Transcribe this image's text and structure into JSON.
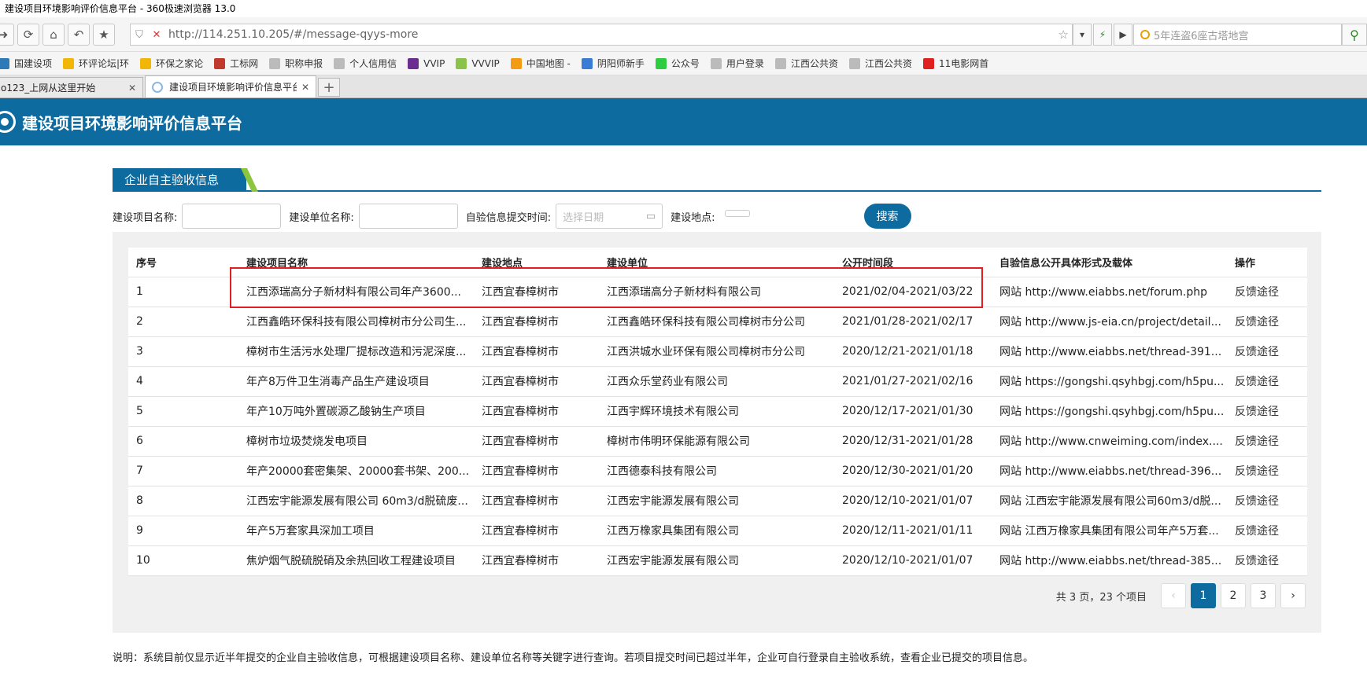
{
  "window": {
    "title": "建设项目环境影响评价信息平台 - 360极速浏览器 13.0"
  },
  "address_bar": {
    "url": "http://114.251.10.205/#/message-qyys-more"
  },
  "search_box": {
    "placeholder": "5年连盗6座古塔地宫"
  },
  "bookmarks": [
    {
      "label": "国建设项",
      "color": "#2e7ab8"
    },
    {
      "label": "环评论坛|环",
      "color": "#f2b705"
    },
    {
      "label": "环保之家论",
      "color": "#f2b705"
    },
    {
      "label": "工标网",
      "color": "#c0392b"
    },
    {
      "label": "职称申报",
      "color": "#bbbbbb"
    },
    {
      "label": "个人信用信",
      "color": "#bbbbbb"
    },
    {
      "label": "VVIP",
      "color": "#6b2d90"
    },
    {
      "label": "VVVIP",
      "color": "#8bc34a"
    },
    {
      "label": "中国地图 -",
      "color": "#f39c12"
    },
    {
      "label": "阴阳师新手",
      "color": "#3a7bd5"
    },
    {
      "label": "公众号",
      "color": "#2ecc40"
    },
    {
      "label": "用户登录",
      "color": "#bbbbbb"
    },
    {
      "label": "江西公共资",
      "color": "#bbbbbb"
    },
    {
      "label": "江西公共资",
      "color": "#bbbbbb"
    },
    {
      "label": "11电影网首",
      "color": "#e02020"
    }
  ],
  "tabs": [
    {
      "label": "o123_上网从这里开始"
    },
    {
      "label": "建设项目环境影响评价信息平台"
    }
  ],
  "site": {
    "title": "建设项目环境影响评价信息平台"
  },
  "section": {
    "title": "企业自主验收信息"
  },
  "filters": {
    "project_name_label": "建设项目名称:",
    "unit_name_label": "建设单位名称:",
    "submit_time_label": "自验信息提交时间:",
    "date_placeholder": "选择日期",
    "location_label": "建设地点:",
    "search_button": "搜索"
  },
  "table": {
    "headers": [
      "序号",
      "建设项目名称",
      "建设地点",
      "建设单位",
      "公开时间段",
      "自验信息公开具体形式及载体",
      "操作"
    ],
    "rows": [
      [
        "1",
        "江西添瑞高分子新材料有限公司年产3600...",
        "江西宜春樟树市",
        "江西添瑞高分子新材料有限公司",
        "2021/02/04-2021/03/22",
        "网站 http://www.eiabbs.net/forum.php",
        "反馈途径"
      ],
      [
        "2",
        "江西鑫皓环保科技有限公司樟树市分公司生...",
        "江西宜春樟树市",
        "江西鑫皓环保科技有限公司樟树市分公司",
        "2021/01/28-2021/02/17",
        "网站 http://www.js-eia.cn/project/detail...",
        "反馈途径"
      ],
      [
        "3",
        "樟树市生活污水处理厂提标改造和污泥深度...",
        "江西宜春樟树市",
        "江西洪城水业环保有限公司樟树市分公司",
        "2020/12/21-2021/01/18",
        "网站 http://www.eiabbs.net/thread-391...",
        "反馈途径"
      ],
      [
        "4",
        "年产8万件卫生消毒产品生产建设项目",
        "江西宜春樟树市",
        "江西众乐堂药业有限公司",
        "2021/01/27-2021/02/16",
        "网站 https://gongshi.qsyhbgj.com/h5pu...",
        "反馈途径"
      ],
      [
        "5",
        "年产10万吨外置碳源乙酸钠生产项目",
        "江西宜春樟树市",
        "江西宇辉环境技术有限公司",
        "2020/12/17-2021/01/30",
        "网站 https://gongshi.qsyhbgj.com/h5pu...",
        "反馈途径"
      ],
      [
        "6",
        "樟树市垃圾焚烧发电项目",
        "江西宜春樟树市",
        "樟树市伟明环保能源有限公司",
        "2020/12/31-2021/01/28",
        "网站 http://www.cnweiming.com/index....",
        "反馈途径"
      ],
      [
        "7",
        "年产20000套密集架、20000套书架、200...",
        "江西宜春樟树市",
        "江西德泰科技有限公司",
        "2020/12/30-2021/01/20",
        "网站 http://www.eiabbs.net/thread-396...",
        "反馈途径"
      ],
      [
        "8",
        "江西宏宇能源发展有限公司 60m3/d脱硫废...",
        "江西宜春樟树市",
        "江西宏宇能源发展有限公司",
        "2020/12/10-2021/01/07",
        "网站 江西宏宇能源发展有限公司60m3/d脱...",
        "反馈途径"
      ],
      [
        "9",
        "年产5万套家具深加工项目",
        "江西宜春樟树市",
        "江西万橡家具集团有限公司",
        "2020/12/11-2021/01/11",
        "网站 江西万橡家具集团有限公司年产5万套...",
        "反馈途径"
      ],
      [
        "10",
        "焦炉烟气脱硫脱硝及余热回收工程建设项目",
        "江西宜春樟树市",
        "江西宏宇能源发展有限公司",
        "2020/12/10-2021/01/07",
        "网站 http://www.eiabbs.net/thread-385...",
        "反馈途径"
      ]
    ]
  },
  "pagination": {
    "info": "共 3 页，23 个项目",
    "prev": "‹",
    "pages": [
      "1",
      "2",
      "3"
    ],
    "next": "›",
    "current": "1"
  },
  "note": "说明：系统目前仅显示近半年提交的企业自主验收信息，可根据建设项目名称、建设单位名称等关键字进行查询。若项目提交时间已超过半年，企业可自行登录自主验收系统，查看企业已提交的项目信息。",
  "colors": {
    "brand": "#0d6ba0",
    "accent": "#8cc63f",
    "highlight": "#e02020"
  }
}
